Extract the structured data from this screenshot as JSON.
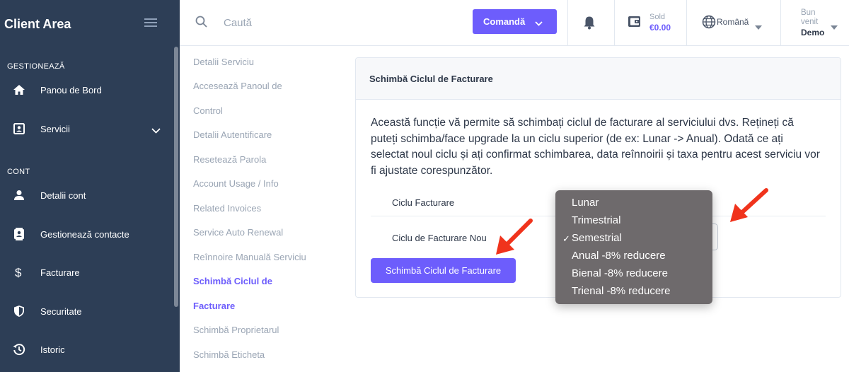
{
  "sidebar": {
    "brand": "Client Area",
    "sections": [
      {
        "title": "GESTIONEAZĂ"
      },
      {
        "title": "CONT"
      }
    ],
    "items": [
      {
        "label": "Panou de Bord",
        "icon": "home-icon"
      },
      {
        "label": "Servicii",
        "icon": "services-icon"
      },
      {
        "label": "Detalii cont",
        "icon": "user-icon"
      },
      {
        "label": "Gestionează contacte",
        "icon": "contacts-icon"
      },
      {
        "label": "Facturare",
        "icon": "dollar-icon"
      },
      {
        "label": "Securitate",
        "icon": "shield-icon"
      },
      {
        "label": "Istoric",
        "icon": "history-icon"
      }
    ]
  },
  "topbar": {
    "search_placeholder": "Caută",
    "order_label": "Comandă",
    "balance_label": "Sold",
    "balance_value": "€0.00",
    "language": "Română",
    "welcome": "Bun venit",
    "username": "Demo"
  },
  "subnav": {
    "items": [
      "Detalii Serviciu",
      "Accesează Panoul de",
      "Control",
      "Detalii Autentificare",
      "Resetează Parola",
      "Account Usage / Info",
      "Related Invoices",
      "Service Auto Renewal",
      "Reînnoire Manuală Serviciu",
      "Schimbă Ciclul de",
      "Facturare",
      "Schimbă Proprietarul",
      "Schimbă Eticheta"
    ]
  },
  "card": {
    "title": "Schimbă Ciclul de Facturare",
    "description": "Această funcție vă permite să schimbați ciclul de facturare al serviciului dvs. Rețineți că puteți schimba/face upgrade la un ciclu superior (de ex: Lunar -> Anual). Odată ce ați selectat noul ciclu și ați confirmat schimbarea, data reînnoirii și taxa pentru acest serviciu vor fi ajustate corespunzător.",
    "current_cycle_label": "Ciclu Facturare",
    "new_cycle_label": "Ciclu de Facturare Nou",
    "submit_label": "Schimbă Ciclul de Facturare"
  },
  "dropdown": {
    "options": [
      "Lunar",
      "Trimestrial",
      "Semestrial",
      "Anual -8% reducere",
      "Bienal -8% reducere",
      "Trienal -8% reducere"
    ],
    "selected": "Semestrial",
    "check_mark": "✓"
  },
  "colors": {
    "sidebar_bg": "#2d3e56",
    "accent": "#6d5dfc",
    "annotation_arrow": "#f0331c"
  }
}
